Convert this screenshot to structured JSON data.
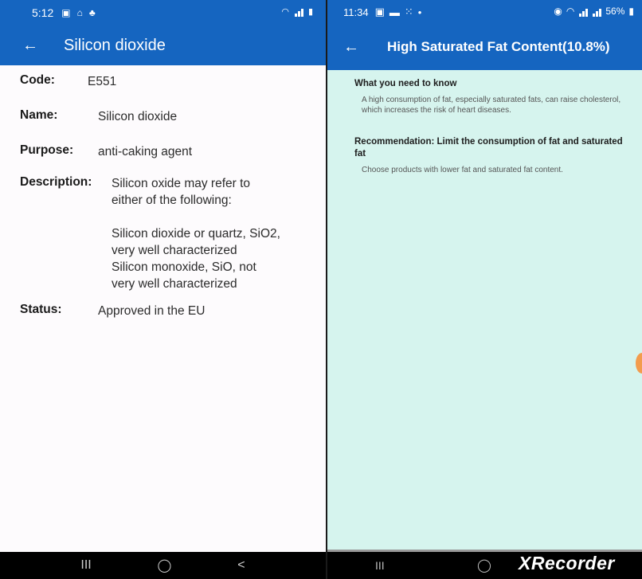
{
  "left": {
    "status": {
      "time": "5:12"
    },
    "appbar": {
      "title": "Silicon dioxide"
    },
    "fields": {
      "code_label": "Code:",
      "code_value": "E551",
      "name_label": "Name:",
      "name_value": "Silicon dioxide",
      "purpose_label": "Purpose:",
      "purpose_value": "anti-caking agent",
      "description_label": "Description:",
      "description_line1": "Silicon oxide may refer to",
      "description_line2": "either of the following:",
      "description_line3": "Silicon dioxide or quartz, SiO2,",
      "description_line4": "very well characterized",
      "description_line5": "Silicon monoxide, SiO, not",
      "description_line6": "very well characterized",
      "status_label": "Status:",
      "status_value": "Approved in the EU"
    },
    "nav": {
      "recent": "III",
      "home": "◯",
      "back": "<"
    }
  },
  "right": {
    "status": {
      "time": "11:34",
      "battery": "56%"
    },
    "appbar": {
      "title": "High Saturated Fat Content(10.8%)"
    },
    "sections": [
      {
        "heading": "What you need to know",
        "body": "A high consumption of fat, especially saturated fats, can raise cholesterol, which increases the risk of heart diseases."
      },
      {
        "heading": "Recommendation: Limit the consumption of fat and saturated fat",
        "body": "Choose products with lower fat and saturated fat content."
      }
    ],
    "nav": {
      "recent": "III",
      "home": "◯",
      "watermark": "XRecorder"
    }
  },
  "colors": {
    "appbar": "#1565c0",
    "right_bg": "#d6f4ee",
    "left_bg": "#fdfbfd"
  }
}
